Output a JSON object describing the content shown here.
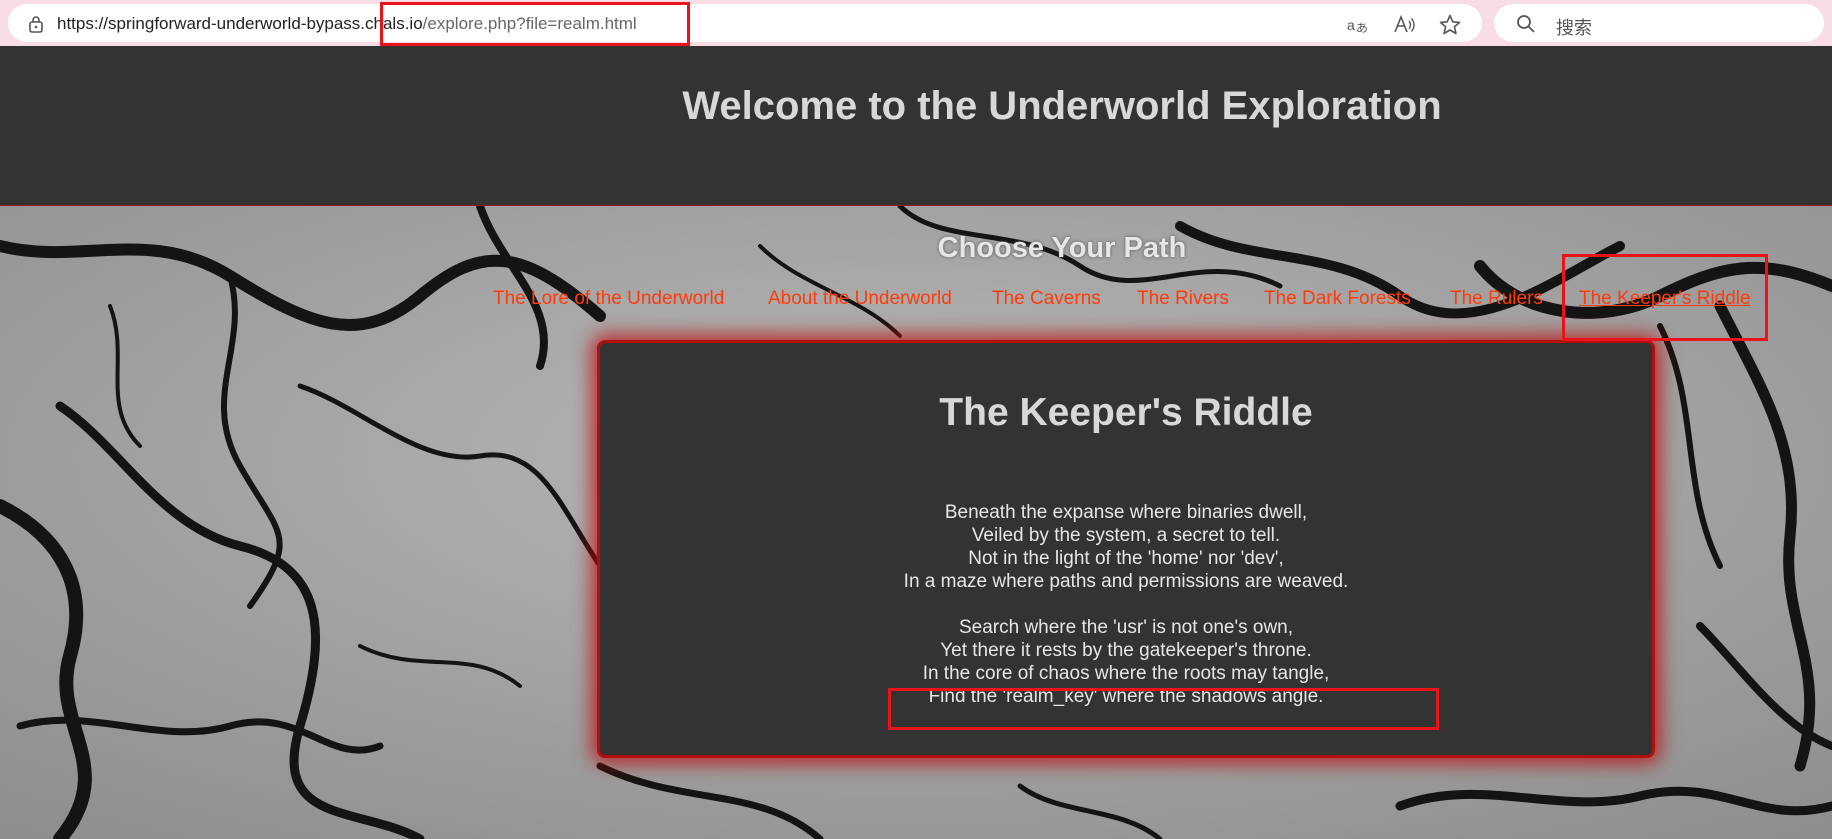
{
  "browser": {
    "url_host": "https://springforward-underworld-bypass.chals.io",
    "url_path": "/explore.php?file=realm.html",
    "search_placeholder": "搜索",
    "icons": [
      "lock-icon",
      "translate-icon",
      "read-aloud-icon",
      "favorite-star-icon",
      "search-icon"
    ]
  },
  "page": {
    "header_title": "Welcome to the Underworld Exploration",
    "nav_title": "Choose Your Path",
    "nav_links": [
      "The Lore of the Underworld",
      "About the Underworld",
      "The Caverns",
      "The Rivers",
      "The Dark Forests",
      "The Rulers",
      "The Keeper's Riddle"
    ],
    "active_link": "The Keeper's Riddle"
  },
  "riddle": {
    "title": "The Keeper's Riddle",
    "stanza1": [
      "Beneath the expanse where binaries dwell,",
      "Veiled by the system, a secret to tell.",
      "Not in the light of the 'home' nor 'dev',",
      "In a maze where paths and permissions are weaved."
    ],
    "stanza2": [
      "Search where the 'usr' is not one's own,",
      "Yet there it rests by the gatekeeper's throne.",
      "In the core of chaos where the roots may tangle,",
      "Find the 'realm_key' where the shadows angle."
    ]
  },
  "colors": {
    "header_bg": "#333333",
    "link": "#ff3b0a",
    "card_border": "#b30f0f",
    "annotation": "#e8141a"
  }
}
